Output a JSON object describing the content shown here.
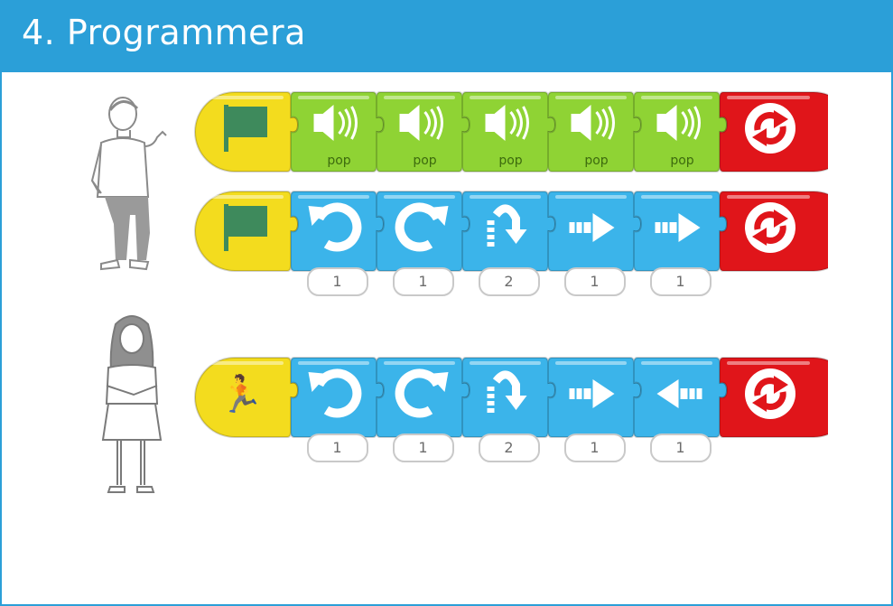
{
  "title": "4. Programmera",
  "colors": {
    "header": "#2b9fd8",
    "trigger_yellow": "#f3dc1e",
    "sound_green": "#8fd334",
    "motion_blue": "#3bb4ea",
    "end_red": "#e0151a"
  },
  "programs": [
    {
      "character": "boy",
      "start": "green-flag",
      "blocks": [
        {
          "type": "sound",
          "icon": "speaker-icon",
          "label": "pop"
        },
        {
          "type": "sound",
          "icon": "speaker-icon",
          "label": "pop"
        },
        {
          "type": "sound",
          "icon": "speaker-icon",
          "label": "pop"
        },
        {
          "type": "sound",
          "icon": "speaker-icon",
          "label": "pop"
        },
        {
          "type": "sound",
          "icon": "speaker-icon",
          "label": "pop"
        }
      ],
      "end": "repeat-forever"
    },
    {
      "character": "boy",
      "start": "green-flag",
      "blocks": [
        {
          "type": "motion",
          "icon": "turn-left-icon",
          "param": "1"
        },
        {
          "type": "motion",
          "icon": "turn-right-icon",
          "param": "1"
        },
        {
          "type": "motion",
          "icon": "hop-icon",
          "param": "2"
        },
        {
          "type": "motion",
          "icon": "move-right-icon",
          "param": "1"
        },
        {
          "type": "motion",
          "icon": "move-right-icon",
          "param": "1"
        }
      ],
      "end": "repeat-forever"
    },
    {
      "character": "girl",
      "start": "start-on-bump",
      "blocks": [
        {
          "type": "motion",
          "icon": "turn-left-icon",
          "param": "1"
        },
        {
          "type": "motion",
          "icon": "turn-right-icon",
          "param": "1"
        },
        {
          "type": "motion",
          "icon": "hop-icon",
          "param": "2"
        },
        {
          "type": "motion",
          "icon": "move-right-icon",
          "param": "1"
        },
        {
          "type": "motion",
          "icon": "move-left-icon",
          "param": "1"
        }
      ],
      "end": "repeat-forever"
    }
  ]
}
